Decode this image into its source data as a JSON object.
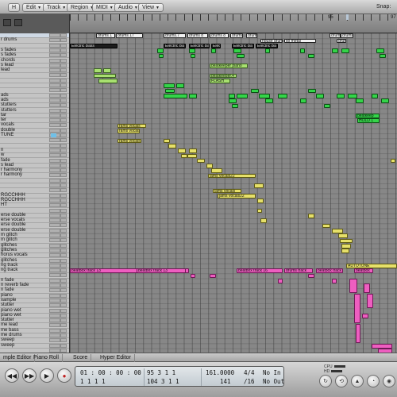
{
  "menubar": {
    "items": [
      {
        "label": "Edit"
      },
      {
        "label": "Track"
      },
      {
        "label": "Region"
      },
      {
        "label": "MIDI"
      },
      {
        "label": "Audio"
      },
      {
        "label": "View"
      }
    ],
    "hide_label": "H",
    "snap_label": "Snap:"
  },
  "ruler": {
    "marks": [
      "95",
      "97"
    ]
  },
  "tracks": [
    "",
    "r drums",
    "",
    "s fades",
    "s fades",
    "chords",
    "s lead",
    "lead",
    "",
    "",
    "",
    "",
    "ads",
    "ads",
    "stutters",
    "stutters",
    "tar",
    "ter",
    "vocals",
    "double",
    "TUNE",
    "",
    "",
    "n",
    "w",
    "fade",
    "s lead",
    "r harmony",
    "r harmony",
    "",
    "",
    "",
    "RGCCHHH",
    "RGCCHHH",
    "HT",
    "",
    "erse double",
    "erse vocals",
    "erse double",
    "erse double",
    "m glitch",
    "m glitch",
    "glitches",
    "glitches",
    "horus vocals",
    "glitches",
    "ng track",
    "ng track",
    "",
    "n fade",
    "n reverb fade",
    "n fade",
    "piano",
    "xample",
    "stutter",
    "piano wet",
    "piano wet",
    "stutter",
    "me lead",
    "me bass",
    "me drums",
    "sweep",
    "sweep",
    ""
  ],
  "regions": [
    {
      "label": "drums 1",
      "color": "white"
    },
    {
      "label": "drums 17",
      "color": "white"
    },
    {
      "label": "drums.7",
      "color": "white"
    },
    {
      "label": "drums 8",
      "color": "white"
    },
    {
      "label": "drums 8",
      "color": "white"
    },
    {
      "label": "drums 8",
      "color": "white"
    },
    {
      "label": "drums 8",
      "color": "white"
    },
    {
      "label": "drums",
      "color": "white"
    },
    {
      "label": "drums",
      "color": "white"
    },
    {
      "label": "house drum",
      "color": "white"
    },
    {
      "label": "so metal",
      "color": "white"
    },
    {
      "label": "drums",
      "color": "white"
    },
    {
      "label": "Electric Bass",
      "color": "dark"
    },
    {
      "label": "Electric Ba",
      "color": "dark"
    },
    {
      "label": "Electric Ba",
      "color": "dark"
    },
    {
      "label": "Elect",
      "color": "dark"
    },
    {
      "label": "Electric Ba",
      "color": "dark"
    },
    {
      "label": "Electric Ba",
      "color": "dark"
    },
    {
      "label": "beatkeeper piano",
      "color": "lgreen"
    },
    {
      "label": "beatkeeper.4",
      "color": "lgreen"
    },
    {
      "label": "FLASH",
      "color": "lgreen"
    },
    {
      "label": "rams vocals",
      "color": "yellow"
    },
    {
      "label": "rams vocals",
      "color": "yellow"
    },
    {
      "label": "rams vocals",
      "color": "yellow"
    },
    {
      "label": "jams vocals22",
      "color": "yellow"
    },
    {
      "label": "jams vocals",
      "color": "yellow"
    },
    {
      "label": "jams vocals22",
      "color": "yellow"
    },
    {
      "label": "AUTOTUNE",
      "color": "yellow"
    },
    {
      "label": "beatkeep",
      "color": "green"
    },
    {
      "label": "HOLD 1",
      "color": "green"
    },
    {
      "label": "beatbox track 13",
      "color": "pink"
    },
    {
      "label": "beatbox track 13",
      "color": "pink"
    },
    {
      "label": "beatbox track 16",
      "color": "pink"
    },
    {
      "label": "drums track",
      "color": "pink"
    },
    {
      "label": "beatbox track",
      "color": "pink"
    },
    {
      "label": "beatbox",
      "color": "pink"
    }
  ],
  "tabs": [
    {
      "label": "mple Editor"
    },
    {
      "label": "Piano Roll"
    },
    {
      "label": "Score"
    },
    {
      "label": "Hyper Editor"
    }
  ],
  "transport": {
    "smpte_top": "01 : 00 : 00 : 00",
    "smpte_bottom": "1     1     1     1",
    "pos_top": "95     3     1     1",
    "pos_bottom": "104     3     1     1",
    "tempo": "161.0000",
    "tempo_bottom": "141",
    "sig_top": "4/4",
    "sig_bottom": "/16",
    "in_label": "No In",
    "out_label": "No Out",
    "cpu_label": "CPU",
    "hd_label": "HD"
  },
  "colors": {
    "green": "#34d449",
    "yellow": "#e6e06a",
    "pink": "#ee5ec0",
    "selection": "#6fc0e8"
  }
}
